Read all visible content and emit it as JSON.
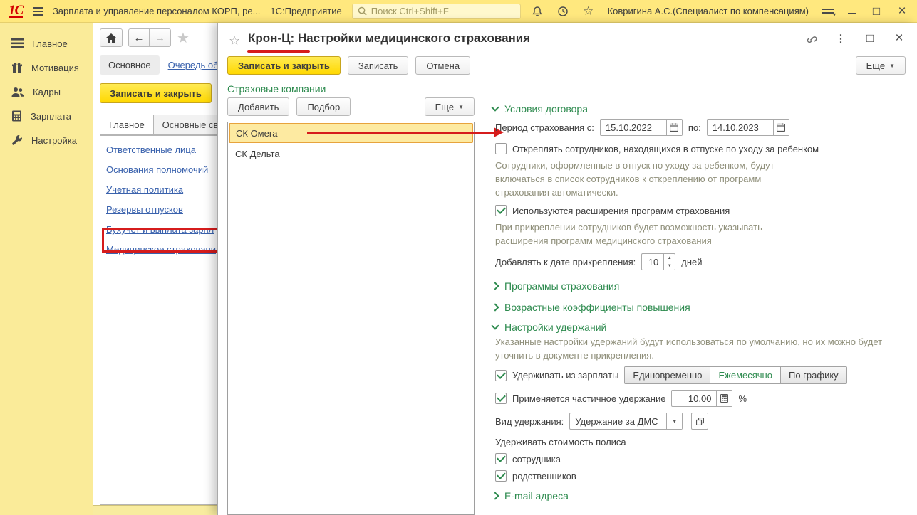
{
  "colors": {
    "accent_yellow": "#ffe87e",
    "sidebar_yellow": "#faeb99",
    "green": "#2e8b4f",
    "link_blue": "#3a62ad",
    "annotation_red": "#d61c1c",
    "selection_yellow": "#fdeaa1",
    "selection_border": "#e7a33c"
  },
  "titlebar": {
    "app_title": "Зарплата и управление персоналом КОРП, ре...",
    "product": "1С:Предприятие",
    "search_placeholder": "Поиск Ctrl+Shift+F",
    "user": "Ковригина А.С.(Специалист по компенсациям)"
  },
  "sidebar": {
    "items": [
      {
        "label": "Главное"
      },
      {
        "label": "Мотивация"
      },
      {
        "label": "Кадры"
      },
      {
        "label": "Зарплата"
      },
      {
        "label": "Настройка"
      }
    ]
  },
  "panel": {
    "tab_main": "Основное",
    "tab_queue": "Очередь обр",
    "save_close": "Записать и закрыть",
    "page_tab_1": "Главное",
    "page_tab_2": "Основные све",
    "links": [
      {
        "label": "Ответственные лица"
      },
      {
        "label": "Основания полномочий"
      },
      {
        "label": "Учетная политика"
      },
      {
        "label": "Резервы отпусков"
      },
      {
        "label": "Бухучет и выплата зарпл"
      },
      {
        "label": "Медицинское страховани"
      }
    ]
  },
  "dialog": {
    "title": "Крон-Ц: Настройки медицинского страхования",
    "save_close": "Записать и закрыть",
    "save": "Записать",
    "cancel": "Отмена",
    "more": "Еще",
    "companies": {
      "header": "Страховые компании",
      "add": "Добавить",
      "pick": "Подбор",
      "more": "Еще",
      "rows": [
        {
          "name": "СК Омега"
        },
        {
          "name": "СК Дельта"
        }
      ]
    },
    "contract": {
      "header": "Условия договора",
      "period_label": "Период страхования с:",
      "date_from": "15.10.2022",
      "to_label": "по:",
      "date_to": "14.10.2023",
      "detach_label": "Откреплять сотрудников, находящихся в отпуске по уходу за ребенком",
      "detach_hint": "Сотрудники, оформленные в отпуск по уходу за ребенком, будут\nвключаться в список сотрудников к откреплению от программ\nстрахования автоматически.",
      "ext_label": "Используются расширения программ страхования",
      "ext_hint": "При прикреплении сотрудников будет возможность указывать\nрасширения программ медицинского страхования",
      "days_label": "Добавлять к дате прикрепления:",
      "days_value": "10",
      "days_suffix": "дней"
    },
    "sections": {
      "programs": "Программы страхования",
      "age": "Возрастные коэффициенты повышения",
      "deductions": "Настройки удержаний",
      "email": "E-mail адреса"
    },
    "deductions": {
      "hint": "Указанные настройки удержаний будут использоваться по умолчанию, но их можно будет\nуточнить в документе прикрепления.",
      "withhold_label": "Удерживать из зарплаты",
      "mode_1": "Единовременно",
      "mode_2": "Ежемесячно",
      "mode_3": "По графику",
      "partial_label": "Применяется частичное удержание",
      "partial_value": "10,00",
      "percent": "%",
      "kind_label": "Вид удержания:",
      "kind_value": "Удержание за ДМС",
      "policy_label": "Удерживать стоимость полиса",
      "employee_label": "сотрудника",
      "relatives_label": "родственников"
    }
  }
}
